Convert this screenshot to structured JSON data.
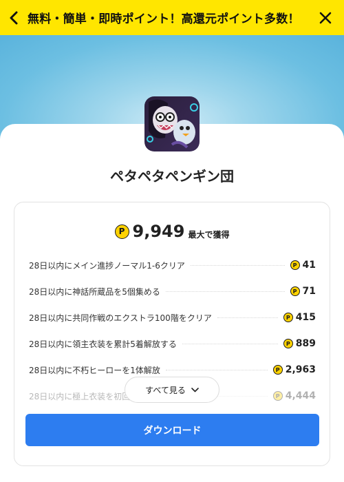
{
  "header": {
    "title": "無料・簡単・即時ポイント！高還元ポイント多数！",
    "back_glyph": "‹",
    "close_glyph": "✕"
  },
  "app": {
    "name": "ペタペタペンギン団"
  },
  "reward": {
    "coin_symbol": "P",
    "total": "9,949",
    "total_suffix": "最大で獲得"
  },
  "missions": [
    {
      "label": "28日以内にメイン進捗ノーマル1-6クリア",
      "points": "41"
    },
    {
      "label": "28日以内に神話所蔵品を5個集める",
      "points": "71"
    },
    {
      "label": "28日以内に共同作戦のエクストラ100階をクリア",
      "points": "415"
    },
    {
      "label": "28日以内に領主衣装を累計5着解放する",
      "points": "889"
    },
    {
      "label": "28日以内に不朽ヒーローを1体解放",
      "points": "2,963"
    },
    {
      "label": "28日以内に極上衣装を初回",
      "points": "4,444"
    }
  ],
  "buttons": {
    "see_all": "すべて見る",
    "download": "ダウンロード"
  },
  "colors": {
    "header_bg": "#ffe600",
    "coin": "#ffd200",
    "primary": "#2d7df0",
    "sky": "#6cbfe2"
  }
}
